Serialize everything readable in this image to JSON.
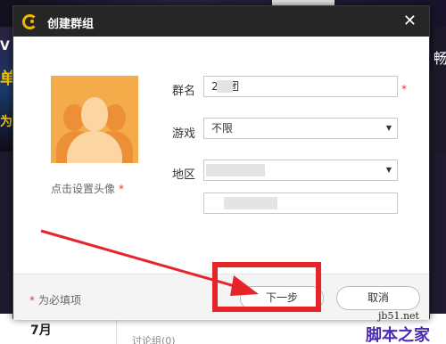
{
  "background": {
    "left_chars": [
      "V",
      "单",
      "为"
    ],
    "right_char": "畅",
    "date": "7月",
    "group_item": "讨论组(0)"
  },
  "dialog": {
    "title": "创建群组",
    "close_symbol": "✕",
    "avatar_label": "点击设置头像",
    "required_mark": "*",
    "fields": {
      "group_name_label": "群名",
      "group_name_value": "2  3团",
      "game_label": "游戏",
      "game_value": "不限",
      "region_label": "地区",
      "region_value": "",
      "region_detail_value": ""
    },
    "footer": {
      "required_note": "为必填项",
      "next_button": "下一步",
      "cancel_button": "取消"
    }
  },
  "watermark": {
    "line1": "jb51.net",
    "line2": "脚本之家"
  },
  "colors": {
    "title_bar": "#262626",
    "logo": "#f1b600",
    "avatar_bg": "#f4ab4a",
    "required": "#e53535",
    "annotation": "#e8242b"
  },
  "icons": {
    "logo": "app-logo-icon",
    "close": "close-icon",
    "dropdown": "chevron-down-icon",
    "avatar": "group-avatar-icon"
  }
}
